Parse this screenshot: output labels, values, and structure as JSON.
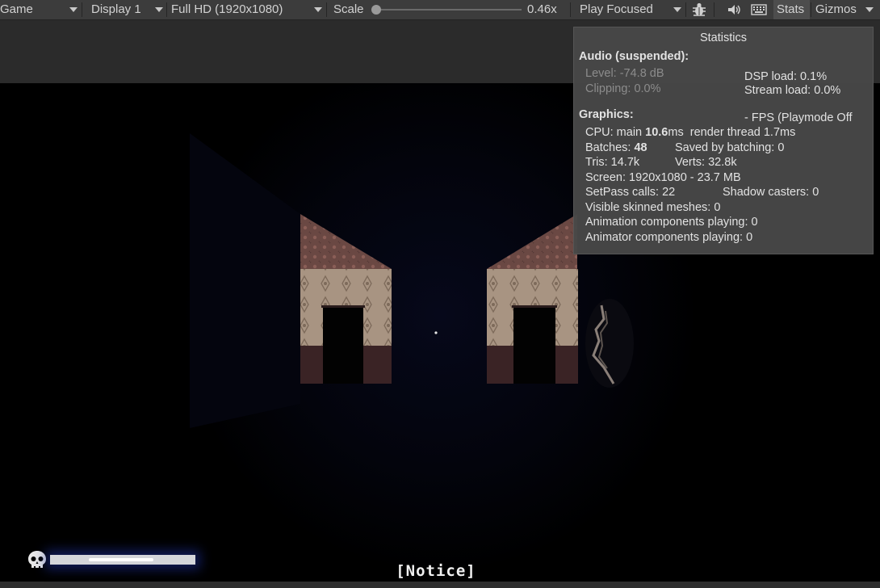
{
  "toolbar": {
    "game_tab": "Game",
    "display": "Display 1",
    "resolution": "Full HD (1920x1080)",
    "scale_label": "Scale",
    "scale_value": "0.46x",
    "play_mode": "Play Focused",
    "stats_label": "Stats",
    "gizmos_label": "Gizmos",
    "icons": [
      "dropdown-arrow-icon",
      "bug-icon",
      "speaker-icon",
      "keyboard-icon"
    ]
  },
  "stats": {
    "title": "Statistics",
    "audio_header": "Audio (suspended):",
    "level": "Level: -74.8 dB",
    "clipping": "Clipping: 0.0%",
    "dsp_load": "DSP load: 0.1%",
    "stream_load": "Stream load: 0.0%",
    "graphics_header": "Graphics:",
    "fps": "- FPS (Playmode Off",
    "cpu_prefix": "CPU: main",
    "cpu_main": "10.6",
    "cpu_suffix": "ms  render thread 1.7ms",
    "batches_prefix": "Batches:",
    "batches": "48",
    "saved_by_batching": "Saved by batching: 0",
    "tris": "Tris: 14.7k",
    "verts": "Verts: 32.8k",
    "screen": "Screen: 1920x1080 - 23.7 MB",
    "setpass": "SetPass calls: 22",
    "shadow_casters": "Shadow casters: 0",
    "skinned": "Visible skinned meshes: 0",
    "animation": "Animation components playing: 0",
    "animator": "Animator components playing: 0"
  },
  "hud": {
    "notice": "[Notice]",
    "health_fraction": 1.0,
    "skull_icon": "skull-icon"
  },
  "colors": {
    "toolbar_bg": "#3c3c3c",
    "panel_bg": "#484848",
    "hud_glow": "#1e32a0"
  }
}
